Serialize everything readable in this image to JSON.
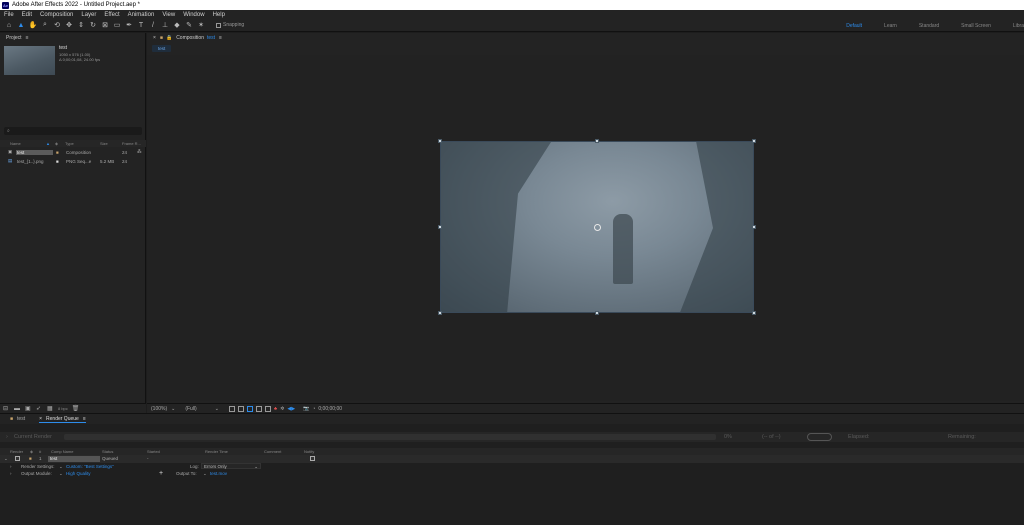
{
  "window": {
    "title": "Adobe After Effects 2022 - Untitled Project.aep *",
    "logo": "Ae"
  },
  "menu": [
    "File",
    "Edit",
    "Composition",
    "Layer",
    "Effect",
    "Animation",
    "View",
    "Window",
    "Help"
  ],
  "toolbar": {
    "snapping_label": "Snapping",
    "workspaces": [
      "Default",
      "Learn",
      "Standard",
      "Small Screen",
      "Libra"
    ],
    "active_workspace": "Default"
  },
  "project": {
    "tab_label": "Project",
    "thumb": {
      "name": "test",
      "dims": "1050 x 576 (1.00)",
      "duration": "Δ 0;00;01;08, 24.00 fps"
    },
    "search_placeholder": "",
    "columns": [
      "Name",
      "Type",
      "Size",
      "Frame R..."
    ],
    "rows": [
      {
        "name": "test",
        "type": "Composition",
        "size": "",
        "fr": "24"
      },
      {
        "name": "test_{1..}.png",
        "type": "PNG Seq...e",
        "size": "5.2 MB",
        "fr": "24"
      }
    ],
    "footer_bpc": "8 bpc"
  },
  "composition": {
    "tab_label": "Composition",
    "tab_comp": "test",
    "sub_tab": "test",
    "zoom": "(100%)",
    "resolution": "(Full)",
    "timecode": "0;00;00;00"
  },
  "render_queue": {
    "tabs": [
      {
        "label": "test",
        "active": false
      },
      {
        "label": "Render Queue",
        "active": true
      }
    ],
    "current_render_label": "Current Render",
    "percent": "0%",
    "of_label": "(-- of --)",
    "elapsed_label": "Elapsed:",
    "remaining_label": "Remaining:",
    "columns": [
      "Render",
      "#",
      "Comp Name",
      "Status",
      "Started",
      "Render Time",
      "Comment",
      "Notify"
    ],
    "row": {
      "index": "1",
      "comp_name": "test",
      "status": "Queued"
    },
    "render_settings_label": "Render Settings:",
    "render_settings_value": "Custom: \"Best Settings\"",
    "log_label": "Log:",
    "log_value": "Errors Only",
    "output_module_label": "Output Module:",
    "output_module_value": "High Quality",
    "output_to_label": "Output To:",
    "output_to_value": "test.mov"
  },
  "colors": {
    "accent": "#2d8ceb",
    "panel_bg": "#232323",
    "app_bg": "#1d1d1d"
  }
}
